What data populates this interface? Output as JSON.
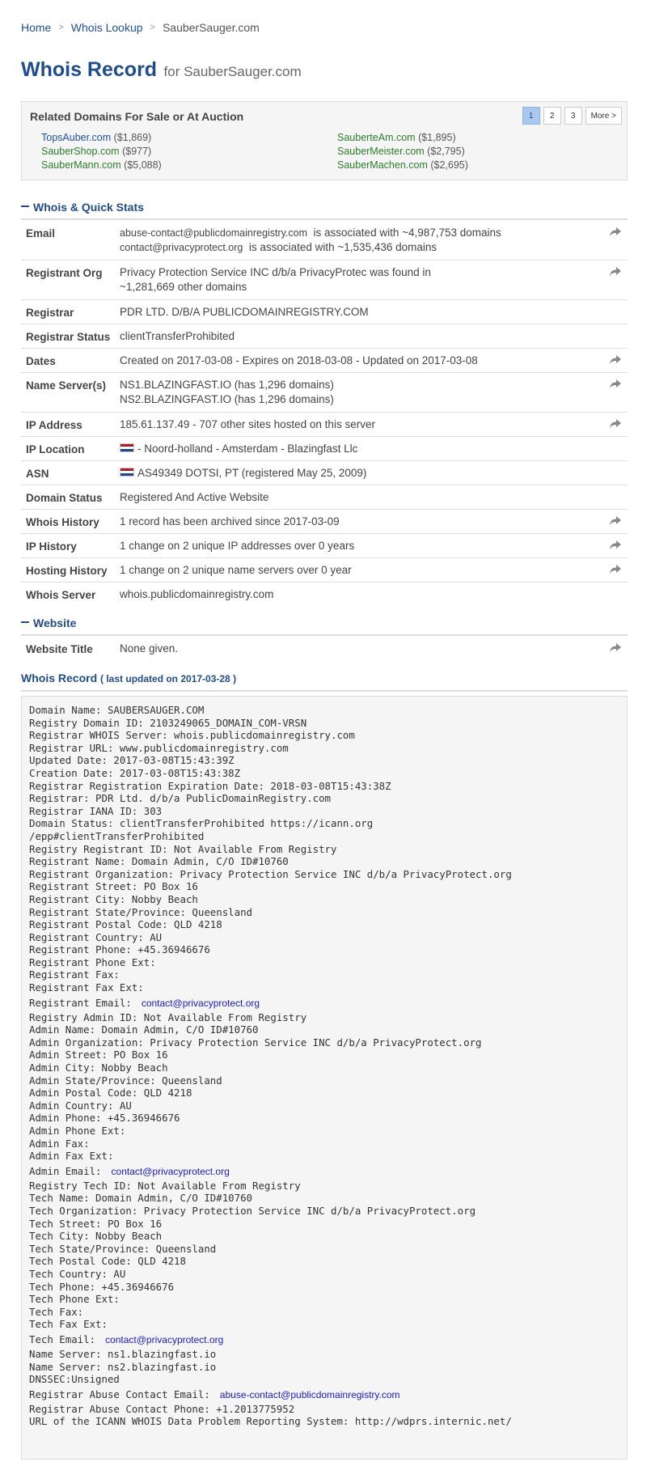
{
  "breadcrumb": {
    "home": "Home",
    "whois": "Whois Lookup",
    "current": "SauberSauger.com"
  },
  "header": {
    "title": "Whois Record",
    "subtitle": "for SauberSauger.com"
  },
  "related": {
    "title": "Related Domains For Sale or At Auction",
    "pages": [
      "1",
      "2",
      "3",
      "More >"
    ],
    "active_page": "1",
    "domains": [
      {
        "name": "TopsAuber.com",
        "price": "($1,869)",
        "color": "blue"
      },
      {
        "name": "SauberteAm.com",
        "price": "($1,895)",
        "color": "green"
      },
      {
        "name": "SauberShop.com",
        "price": "($977)",
        "color": "green"
      },
      {
        "name": "SauberMeister.com",
        "price": "($2,795)",
        "color": "green"
      },
      {
        "name": "SauberMann.com",
        "price": "($5,088)",
        "color": "green"
      },
      {
        "name": "SauberMachen.com",
        "price": "($2,695)",
        "color": "green"
      }
    ]
  },
  "quick_stats": {
    "heading": "Whois & Quick Stats",
    "email": {
      "label": "Email",
      "line1_addr": "abuse-contact@publicdomainregistry.com",
      "line1_text": "is associated with ~4,987,753 domains",
      "line2_addr": "contact@privacyprotect.org",
      "line2_text": "is associated with ~1,535,436 domains"
    },
    "registrant_org": {
      "label": "Registrant Org",
      "line1": "Privacy Protection Service INC d/b/a PrivacyProtec was found in",
      "line2": "~1,281,669 other domains"
    },
    "registrar": {
      "label": "Registrar",
      "value": "PDR LTD. D/B/A PUBLICDOMAINREGISTRY.COM"
    },
    "registrar_status": {
      "label": "Registrar Status",
      "value": "clientTransferProhibited"
    },
    "dates": {
      "label": "Dates",
      "value": "Created on 2017-03-08 - Expires on 2018-03-08 - Updated on 2017-03-08"
    },
    "name_servers": {
      "label": "Name Server(s)",
      "line1": "NS1.BLAZINGFAST.IO (has 1,296 domains)",
      "line2": "NS2.BLAZINGFAST.IO (has 1,296 domains)"
    },
    "ip_address": {
      "label": "IP Address",
      "value": "185.61.137.49 - 707 other sites hosted on this server"
    },
    "ip_location": {
      "label": "IP Location",
      "value": "- Noord-holland - Amsterdam - Blazingfast Llc",
      "flag": "netherlands-flag-icon"
    },
    "asn": {
      "label": "ASN",
      "value": "AS49349 DOTSI, PT (registered May 25, 2009)",
      "flag": "netherlands-flag-icon"
    },
    "domain_status": {
      "label": "Domain Status",
      "value": "Registered And Active Website"
    },
    "whois_history": {
      "label": "Whois History",
      "value": "1 record has been archived since 2017-03-09"
    },
    "ip_history": {
      "label": "IP History",
      "value": "1 change on 2 unique IP addresses over 0 years"
    },
    "hosting_history": {
      "label": "Hosting History",
      "value": "1 change on 2 unique name servers over 0 year"
    },
    "whois_server": {
      "label": "Whois Server",
      "value": "whois.publicdomainregistry.com"
    }
  },
  "website": {
    "heading": "Website",
    "title_label": "Website Title",
    "title_value": "None given."
  },
  "record": {
    "heading": "Whois Record",
    "updated": "( last updated on 2017-03-28 )",
    "lines": [
      "Domain Name: SAUBERSAUGER.COM",
      "Registry Domain ID: 2103249065_DOMAIN_COM-VRSN",
      "Registrar WHOIS Server: whois.publicdomainregistry.com",
      "Registrar URL: www.publicdomainregistry.com",
      "Updated Date: 2017-03-08T15:43:39Z",
      "Creation Date: 2017-03-08T15:43:38Z",
      "Registrar Registration Expiration Date: 2018-03-08T15:43:38Z",
      "Registrar: PDR Ltd. d/b/a PublicDomainRegistry.com",
      "Registrar IANA ID: 303",
      "Domain Status: clientTransferProhibited https://icann.org",
      "/epp#clientTransferProhibited",
      "Registry Registrant ID: Not Available From Registry",
      "Registrant Name: Domain Admin, C/O ID#10760",
      "Registrant Organization: Privacy Protection Service INC d/b/a PrivacyProtect.org",
      "Registrant Street: PO Box 16",
      "Registrant City: Nobby Beach",
      "Registrant State/Province: Queensland",
      "Registrant Postal Code: QLD 4218",
      "Registrant Country: AU",
      "Registrant Phone: +45.36946676",
      "Registrant Phone Ext:",
      "Registrant Fax:",
      "Registrant Fax Ext:",
      {
        "label": "Registrant Email:",
        "email": "contact@privacyprotect.org"
      },
      "Registry Admin ID: Not Available From Registry",
      "Admin Name: Domain Admin, C/O ID#10760",
      "Admin Organization: Privacy Protection Service INC d/b/a PrivacyProtect.org",
      "Admin Street: PO Box 16",
      "Admin City: Nobby Beach",
      "Admin State/Province: Queensland",
      "Admin Postal Code: QLD 4218",
      "Admin Country: AU",
      "Admin Phone: +45.36946676",
      "Admin Phone Ext:",
      "Admin Fax:",
      "Admin Fax Ext:",
      {
        "label": "Admin Email:",
        "email": "contact@privacyprotect.org"
      },
      "Registry Tech ID: Not Available From Registry",
      "Tech Name: Domain Admin, C/O ID#10760",
      "Tech Organization: Privacy Protection Service INC d/b/a PrivacyProtect.org",
      "Tech Street: PO Box 16",
      "Tech City: Nobby Beach",
      "Tech State/Province: Queensland",
      "Tech Postal Code: QLD 4218",
      "Tech Country: AU",
      "Tech Phone: +45.36946676",
      "Tech Phone Ext:",
      "Tech Fax:",
      "Tech Fax Ext:",
      {
        "label": "Tech Email:",
        "email": "contact@privacyprotect.org"
      },
      "Name Server: ns1.blazingfast.io",
      "Name Server: ns2.blazingfast.io",
      "DNSSEC:Unsigned",
      {
        "label": "Registrar Abuse Contact Email:",
        "email": "abuse-contact@publicdomainregistry.com"
      },
      "Registrar Abuse Contact Phone: +1.2013775952",
      "URL of the ICANN WHOIS Data Problem Reporting System: http://wdprs.internic.net/"
    ]
  },
  "colors": {
    "brand": "#1f4c8f",
    "link": "#1f4fa3",
    "green_link": "#2a7f2a",
    "email_link": "#1a1acc"
  }
}
